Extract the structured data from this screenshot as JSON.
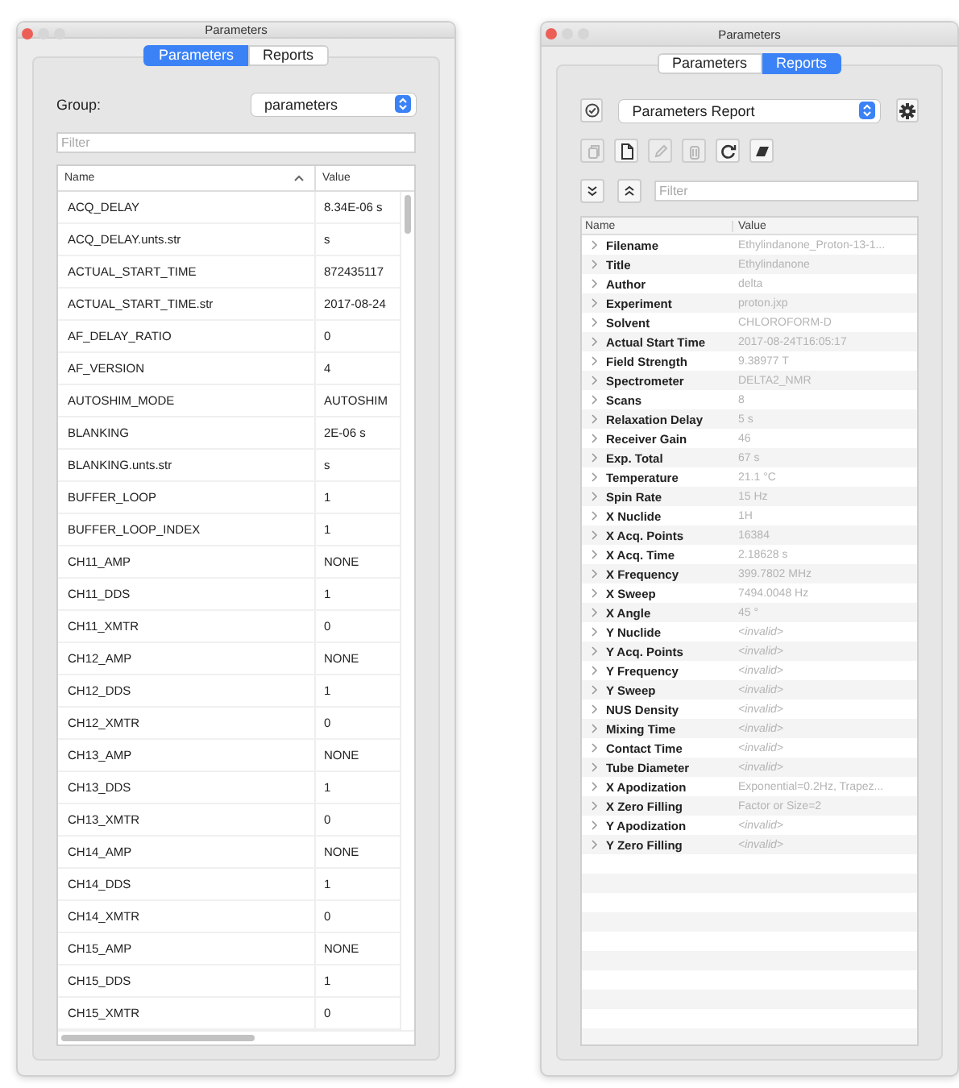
{
  "parameters_window": {
    "title": "Parameters",
    "tabs": [
      {
        "label": "Parameters",
        "selected": true
      },
      {
        "label": "Reports",
        "selected": false
      }
    ],
    "group": {
      "label": "Group:",
      "value": "parameters"
    },
    "filter": {
      "placeholder": "Filter"
    },
    "table": {
      "columns": [
        "Name",
        "Value"
      ],
      "rows": [
        {
          "name": "ACQ_DELAY",
          "value": "8.34E-06 s"
        },
        {
          "name": "ACQ_DELAY.unts.str",
          "value": "s"
        },
        {
          "name": "ACTUAL_START_TIME",
          "value": "872435117"
        },
        {
          "name": "ACTUAL_START_TIME.str",
          "value": "2017-08-24"
        },
        {
          "name": "AF_DELAY_RATIO",
          "value": "0"
        },
        {
          "name": "AF_VERSION",
          "value": "4"
        },
        {
          "name": "AUTOSHIM_MODE",
          "value": "AUTOSHIM"
        },
        {
          "name": "BLANKING",
          "value": "2E-06 s"
        },
        {
          "name": "BLANKING.unts.str",
          "value": "s"
        },
        {
          "name": "BUFFER_LOOP",
          "value": "1"
        },
        {
          "name": "BUFFER_LOOP_INDEX",
          "value": "1"
        },
        {
          "name": "CH11_AMP",
          "value": "NONE"
        },
        {
          "name": "CH11_DDS",
          "value": "1"
        },
        {
          "name": "CH11_XMTR",
          "value": "0"
        },
        {
          "name": "CH12_AMP",
          "value": "NONE"
        },
        {
          "name": "CH12_DDS",
          "value": "1"
        },
        {
          "name": "CH12_XMTR",
          "value": "0"
        },
        {
          "name": "CH13_AMP",
          "value": "NONE"
        },
        {
          "name": "CH13_DDS",
          "value": "1"
        },
        {
          "name": "CH13_XMTR",
          "value": "0"
        },
        {
          "name": "CH14_AMP",
          "value": "NONE"
        },
        {
          "name": "CH14_DDS",
          "value": "1"
        },
        {
          "name": "CH14_XMTR",
          "value": "0"
        },
        {
          "name": "CH15_AMP",
          "value": "NONE"
        },
        {
          "name": "CH15_DDS",
          "value": "1"
        },
        {
          "name": "CH15_XMTR",
          "value": "0"
        }
      ]
    }
  },
  "reports_window": {
    "title": "Parameters",
    "tabs": [
      {
        "label": "Parameters",
        "selected": false
      },
      {
        "label": "Reports",
        "selected": true
      }
    ],
    "report": {
      "value": "Parameters Report"
    },
    "toolbar": [
      {
        "kind": "copy",
        "disabled": true
      },
      {
        "kind": "document",
        "disabled": false
      },
      {
        "kind": "pencil",
        "disabled": true
      },
      {
        "kind": "trash",
        "disabled": true
      },
      {
        "kind": "refresh",
        "disabled": false
      },
      {
        "kind": "eraser",
        "disabled": false
      }
    ],
    "filter": {
      "placeholder": "Filter"
    },
    "table": {
      "columns": [
        "Name",
        "Value"
      ],
      "rows": [
        {
          "name": "Filename",
          "value": "Ethylindanone_Proton-13-1...",
          "invalid": false
        },
        {
          "name": "Title",
          "value": "Ethylindanone",
          "invalid": false
        },
        {
          "name": "Author",
          "value": "delta",
          "invalid": false
        },
        {
          "name": "Experiment",
          "value": "proton.jxp",
          "invalid": false
        },
        {
          "name": "Solvent",
          "value": "CHLOROFORM-D",
          "invalid": false
        },
        {
          "name": "Actual Start Time",
          "value": "2017-08-24T16:05:17",
          "invalid": false
        },
        {
          "name": "Field Strength",
          "value": "9.38977 T",
          "invalid": false
        },
        {
          "name": "Spectrometer",
          "value": "DELTA2_NMR",
          "invalid": false
        },
        {
          "name": "Scans",
          "value": "8",
          "invalid": false
        },
        {
          "name": "Relaxation Delay",
          "value": "5 s",
          "invalid": false
        },
        {
          "name": "Receiver Gain",
          "value": "46",
          "invalid": false
        },
        {
          "name": "Exp. Total",
          "value": "67 s",
          "invalid": false
        },
        {
          "name": "Temperature",
          "value": "21.1 °C",
          "invalid": false
        },
        {
          "name": "Spin Rate",
          "value": "15 Hz",
          "invalid": false
        },
        {
          "name": "X Nuclide",
          "value": "1H",
          "invalid": false
        },
        {
          "name": "X Acq. Points",
          "value": "16384",
          "invalid": false
        },
        {
          "name": "X Acq. Time",
          "value": "2.18628 s",
          "invalid": false
        },
        {
          "name": "X Frequency",
          "value": "399.7802 MHz",
          "invalid": false
        },
        {
          "name": "X Sweep",
          "value": "7494.0048 Hz",
          "invalid": false
        },
        {
          "name": "X Angle",
          "value": "45 °",
          "invalid": false
        },
        {
          "name": "Y Nuclide",
          "value": "<invalid>",
          "invalid": true
        },
        {
          "name": "Y Acq. Points",
          "value": "<invalid>",
          "invalid": true
        },
        {
          "name": "Y Frequency",
          "value": "<invalid>",
          "invalid": true
        },
        {
          "name": "Y Sweep",
          "value": "<invalid>",
          "invalid": true
        },
        {
          "name": "NUS Density",
          "value": "<invalid>",
          "invalid": true
        },
        {
          "name": "Mixing Time",
          "value": "<invalid>",
          "invalid": true
        },
        {
          "name": "Contact Time",
          "value": "<invalid>",
          "invalid": true
        },
        {
          "name": "Tube Diameter",
          "value": "<invalid>",
          "invalid": true
        },
        {
          "name": "X Apodization",
          "value": "Exponential=0.2Hz, Trapez...",
          "invalid": false
        },
        {
          "name": "X Zero Filling",
          "value": "Factor or Size=2",
          "invalid": false
        },
        {
          "name": "Y Apodization",
          "value": "<invalid>",
          "invalid": true
        },
        {
          "name": "Y Zero Filling",
          "value": "<invalid>",
          "invalid": true
        }
      ]
    }
  }
}
